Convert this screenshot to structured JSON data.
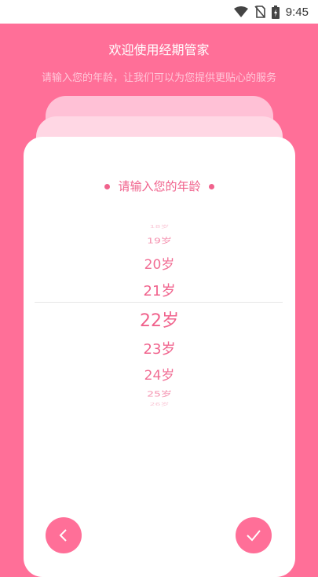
{
  "status_bar": {
    "time": "9:45",
    "icons": [
      "wifi-icon",
      "no-sim-icon",
      "battery-charging-icon"
    ]
  },
  "header": {
    "title": "欢迎使用经期管家",
    "subtitle": "请输入您的年龄，让我们可以为您提供更贴心的服务"
  },
  "card": {
    "title": "请输入您的年龄"
  },
  "age_picker": {
    "selected": "22岁",
    "items": [
      "18岁",
      "19岁",
      "20岁",
      "21岁",
      "22岁",
      "23岁",
      "24岁",
      "25岁",
      "26岁"
    ]
  },
  "buttons": {
    "back_icon": "chevron-left-icon",
    "confirm_icon": "check-icon"
  },
  "colors": {
    "background": "#ff6f98",
    "accent": "#f0628c",
    "card": "#ffffff",
    "stack_light": "#ffd7e4",
    "stack_mid": "#ffc1d6"
  }
}
